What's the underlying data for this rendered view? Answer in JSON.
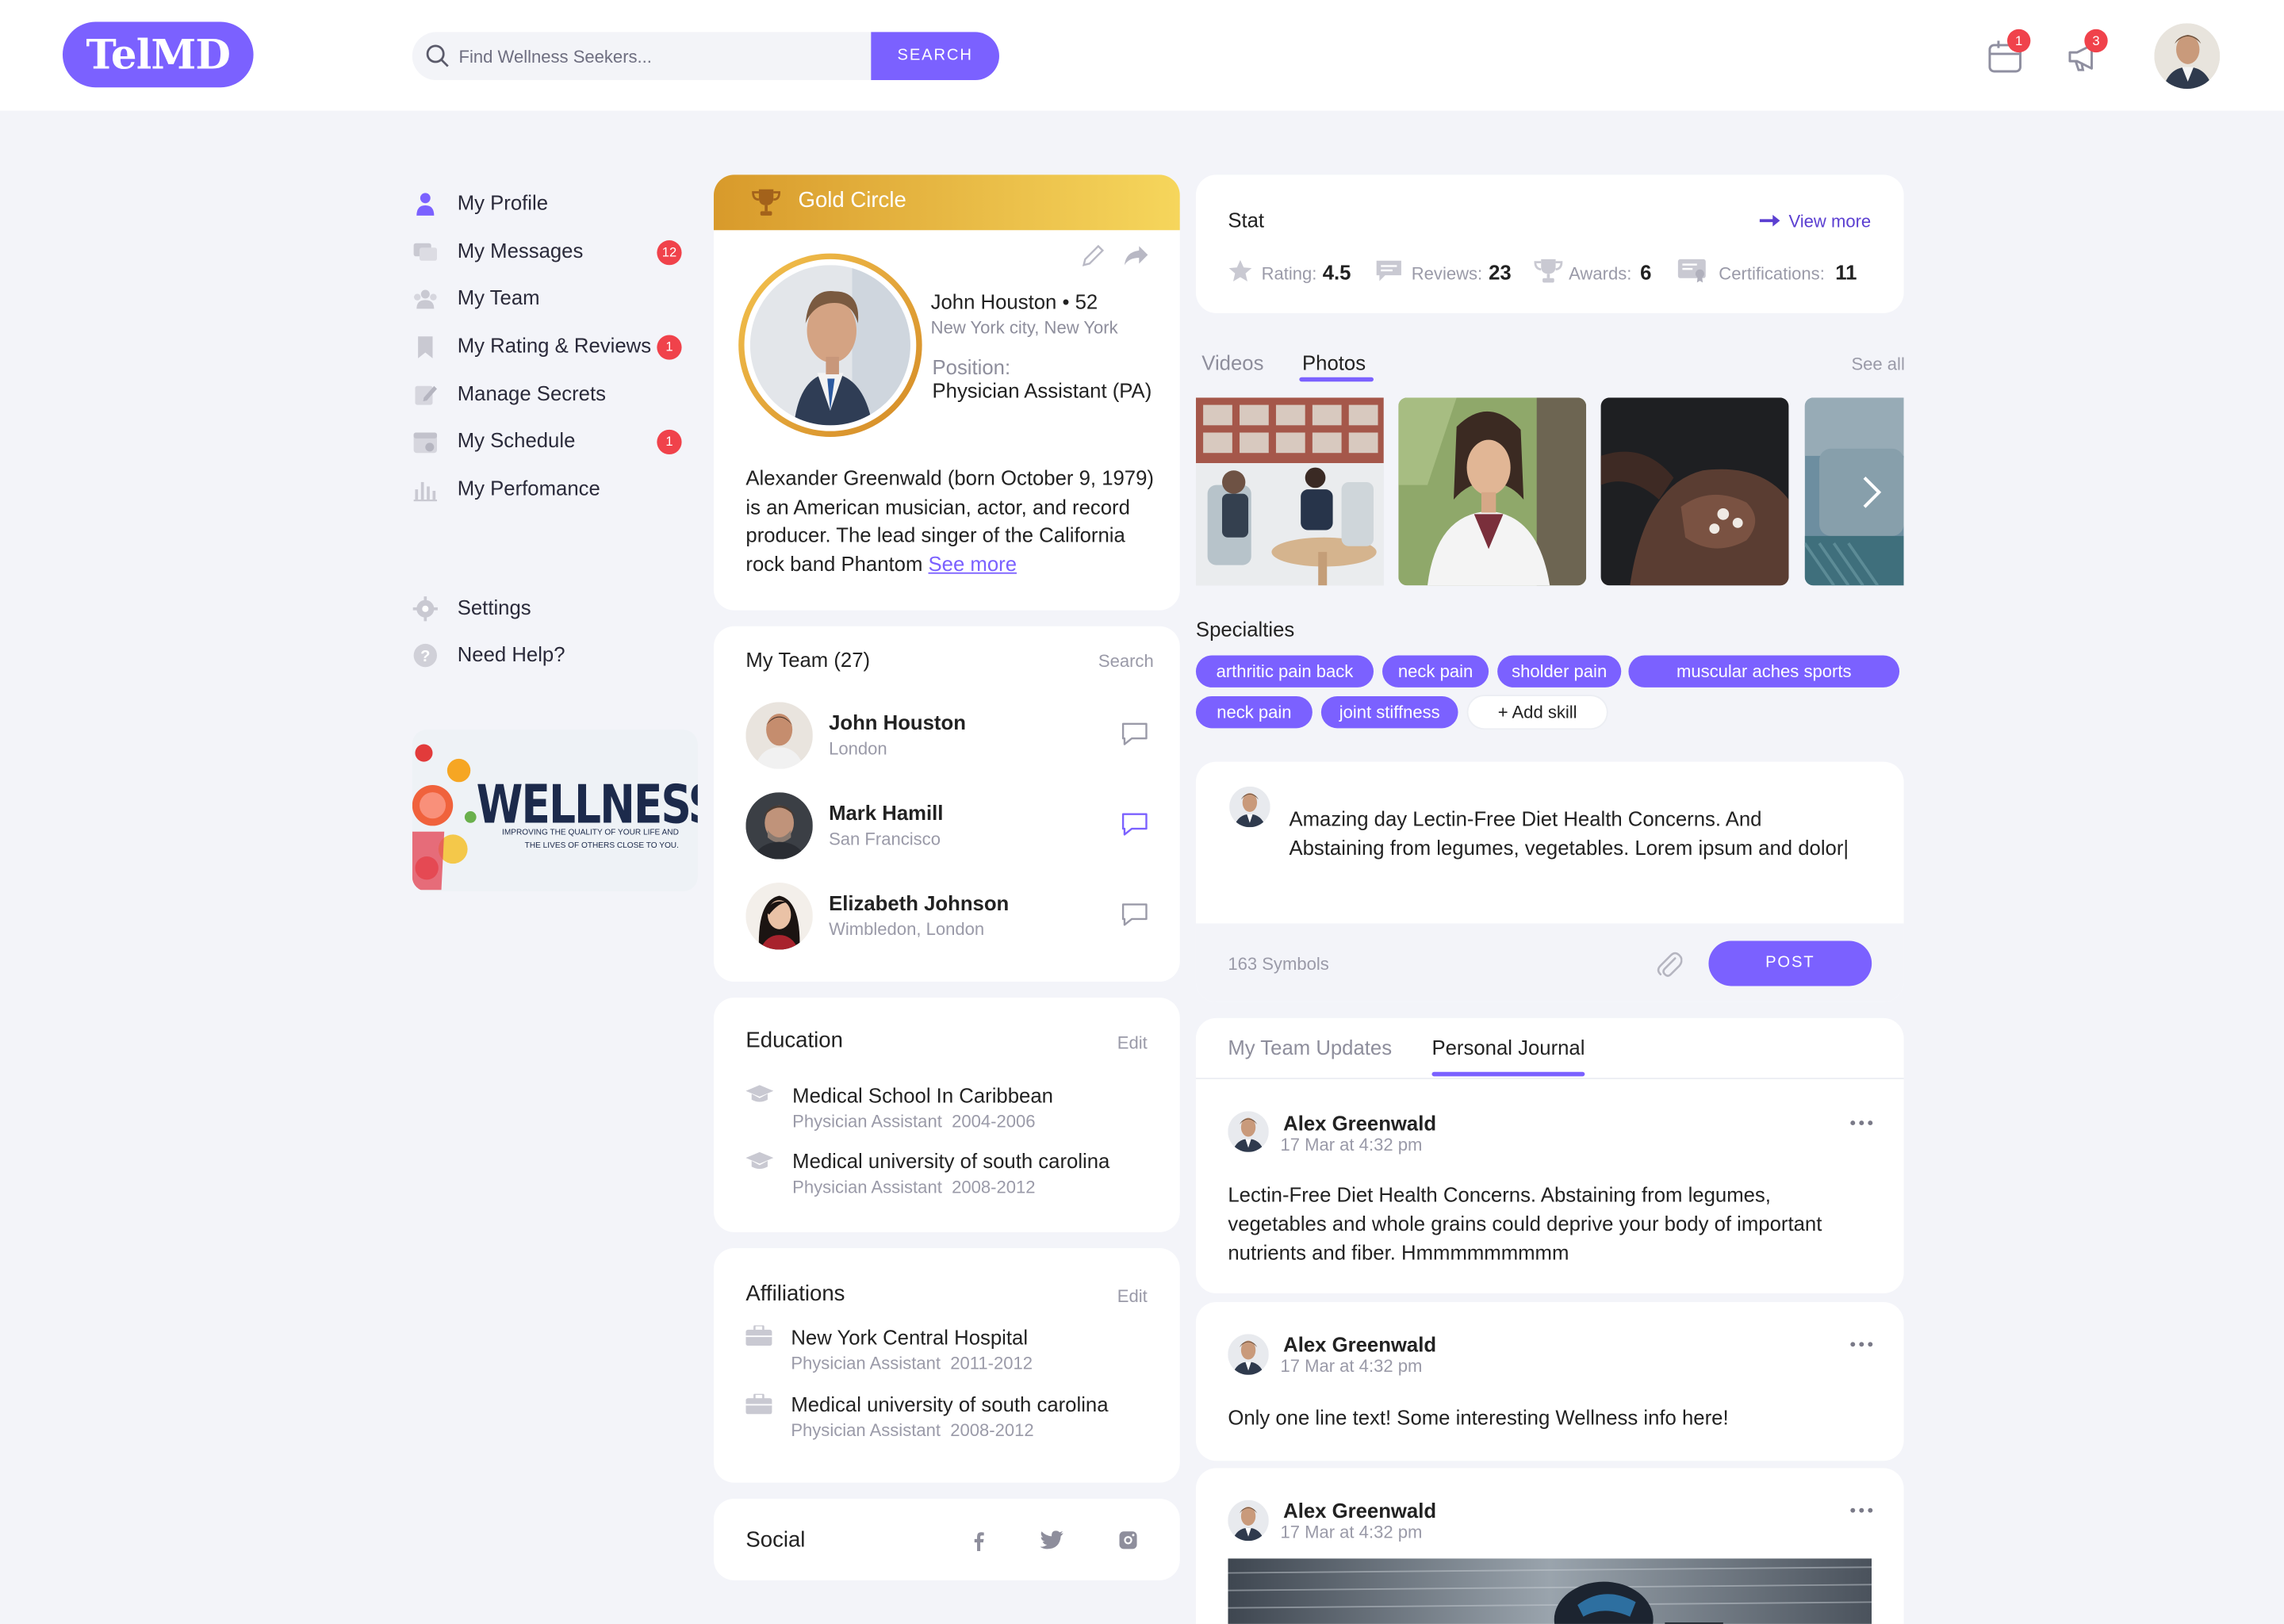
{
  "app": {
    "logo_text": "TelMD"
  },
  "header": {
    "search_placeholder": "Find Wellness Seekers...",
    "search_button": "SEARCH",
    "calendar_badge": "1",
    "notifications_badge": "3"
  },
  "sidebar": {
    "items": [
      {
        "label": "My Profile",
        "icon": "user-icon",
        "count": null
      },
      {
        "label": "My Messages",
        "icon": "messages-icon",
        "count": "12"
      },
      {
        "label": "My Team",
        "icon": "team-icon",
        "count": null
      },
      {
        "label": "My Rating & Reviews",
        "icon": "bookmark-icon",
        "count": "1"
      },
      {
        "label": "Manage Secrets",
        "icon": "edit-icon",
        "count": null
      },
      {
        "label": "My Schedule",
        "icon": "calendar-icon",
        "count": "1"
      },
      {
        "label": "My Perfomance",
        "icon": "chart-icon",
        "count": null
      }
    ],
    "settings": "Settings",
    "help": "Need Help?",
    "banner": {
      "title": "WELLNESS",
      "subtitle_line1": "IMPROVING THE QUALITY OF YOUR LIFE AND",
      "subtitle_line2": "THE LIVES OF OTHERS CLOSE TO YOU."
    }
  },
  "profile": {
    "tier": "Gold Circle",
    "name": "John Houston • 52",
    "location": "New York city, New York",
    "position_label": "Position:",
    "position": "Physician Assistant (PA)",
    "bio": "Alexander Greenwald (born October 9, 1979) is an American musician, actor, and record producer. The lead singer of the California rock band Phantom",
    "see_more": "See more"
  },
  "team": {
    "title": "My Team (27)",
    "search": "Search",
    "members": [
      {
        "name": "John Houston",
        "location": "London"
      },
      {
        "name": "Mark Hamill",
        "location": "San Francisco"
      },
      {
        "name": "Elizabeth Johnson",
        "location": "Wimbledon, London"
      }
    ]
  },
  "education": {
    "title": "Education",
    "edit": "Edit",
    "items": [
      {
        "school": "Medical School In Caribbean",
        "role": "Physician Assistant",
        "years": "2004-2006"
      },
      {
        "school": "Medical university of south carolina",
        "role": "Physician Assistant",
        "years": "2008-2012"
      }
    ]
  },
  "affiliations": {
    "title": "Affiliations",
    "edit": "Edit",
    "items": [
      {
        "org": "New York Central Hospital",
        "role": "Physician Assistant",
        "years": "2011-2012"
      },
      {
        "org": "Medical university of south carolina",
        "role": "Physician Assistant",
        "years": "2008-2012"
      }
    ]
  },
  "social": {
    "title": "Social",
    "icons": [
      "facebook-icon",
      "twitter-icon",
      "instagram-icon"
    ]
  },
  "stat": {
    "title": "Stat",
    "view_more": "View more",
    "rating_label": "Rating:",
    "rating": "4.5",
    "reviews_label": "Reviews:",
    "reviews": "23",
    "awards_label": "Awards:",
    "awards": "6",
    "certs_label": "Certifications:",
    "certs": "11"
  },
  "media": {
    "tab_videos": "Videos",
    "tab_photos": "Photos",
    "see_all": "See all"
  },
  "specialties": {
    "title": "Specialties",
    "tags": [
      "arthritic pain back",
      "neck pain",
      "sholder pain",
      "muscular aches sports",
      "neck pain",
      "joint stiffness"
    ],
    "add_skill": "+ Add skill"
  },
  "composer": {
    "text": "Amazing day Lectin-Free Diet Health Concerns. And Abstaining from legumes, vegetables. Lorem ipsum and dolor|",
    "symbols": "163 Symbols",
    "post_button": "POST"
  },
  "feed": {
    "tab_team": "My Team Updates",
    "tab_journal": "Personal Journal",
    "posts": [
      {
        "author": "Alex Greenwald",
        "time": "17 Mar at 4:32 pm",
        "text": "Lectin-Free Diet Health Concerns. Abstaining from legumes, vegetables and whole grains could deprive your body of important nutrients and fiber. Hmmmmmmmmm"
      },
      {
        "author": "Alex Greenwald",
        "time": "17 Mar at 4:32 pm",
        "text": "Only one line text! Some interesting Wellness info here!"
      },
      {
        "author": "Alex Greenwald",
        "time": "17 Mar at 4:32 pm",
        "text": ""
      }
    ]
  },
  "colors": {
    "accent": "#7b61ff",
    "badge": "#f0424b",
    "gold_start": "#d89a2b",
    "gold_end": "#f6d65c",
    "background": "#f3f4f9"
  }
}
